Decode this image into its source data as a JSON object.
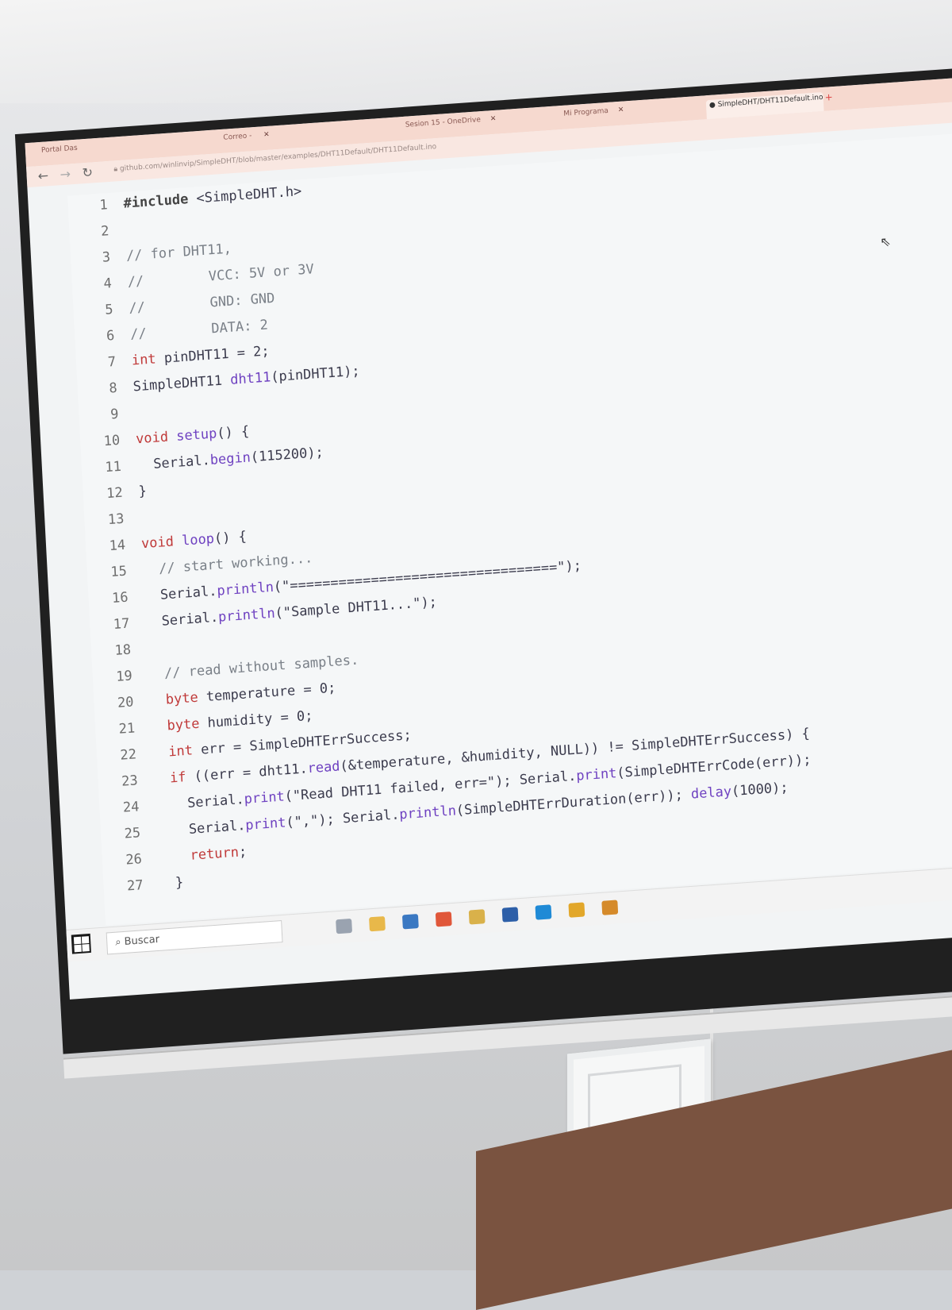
{
  "browser": {
    "tabs": [
      {
        "label": "Portal Das",
        "active": false
      },
      {
        "label": "Correo - ",
        "active": false
      },
      {
        "label": "Sesion 15 - OneDrive",
        "active": false
      },
      {
        "label": "Mi Programa",
        "active": false
      },
      {
        "label": "SimpleDHT/DHT11Default.ino",
        "active": true
      }
    ],
    "new_tab_label": "+",
    "url": "github.com/winlinvip/SimpleDHT/blob/master/examples/DHT11Default/DHT11Default.ino"
  },
  "code_lines": [
    {
      "n": "1",
      "text": "#include <SimpleDHT.h>"
    },
    {
      "n": "2",
      "text": ""
    },
    {
      "n": "3",
      "text": "// for DHT11,"
    },
    {
      "n": "4",
      "text": "//        VCC: 5V or 3V"
    },
    {
      "n": "5",
      "text": "//        GND: GND"
    },
    {
      "n": "6",
      "text": "//        DATA: 2"
    },
    {
      "n": "7",
      "text": "int pinDHT11 = 2;"
    },
    {
      "n": "8",
      "text": "SimpleDHT11 dht11(pinDHT11);"
    },
    {
      "n": "9",
      "text": ""
    },
    {
      "n": "10",
      "text": "void setup() {"
    },
    {
      "n": "11",
      "text": "  Serial.begin(115200);"
    },
    {
      "n": "12",
      "text": "}"
    },
    {
      "n": "13",
      "text": ""
    },
    {
      "n": "14",
      "text": "void loop() {"
    },
    {
      "n": "15",
      "text": "  // start working..."
    },
    {
      "n": "16",
      "text": "  Serial.println(\"=================================\");"
    },
    {
      "n": "17",
      "text": "  Serial.println(\"Sample DHT11...\");"
    },
    {
      "n": "18",
      "text": ""
    },
    {
      "n": "19",
      "text": "  // read without samples."
    },
    {
      "n": "20",
      "text": "  byte temperature = 0;"
    },
    {
      "n": "21",
      "text": "  byte humidity = 0;"
    },
    {
      "n": "22",
      "text": "  int err = SimpleDHTErrSuccess;"
    },
    {
      "n": "23",
      "text": "  if ((err = dht11.read(&temperature, &humidity, NULL)) != SimpleDHTErrSuccess) {"
    },
    {
      "n": "24",
      "text": "    Serial.print(\"Read DHT11 failed, err=\"); Serial.print(SimpleDHTErrCode(err));"
    },
    {
      "n": "25",
      "text": "    Serial.print(\",\"); Serial.println(SimpleDHTErrDuration(err)); delay(1000);"
    },
    {
      "n": "26",
      "text": "    return;"
    },
    {
      "n": "27",
      "text": "  }"
    }
  ],
  "taskbar": {
    "search_placeholder": "Buscar",
    "icons": [
      "task-view-icon",
      "file-explorer-icon",
      "mail-icon",
      "brave-icon",
      "files-icon",
      "word-icon",
      "edge-icon",
      "chrome-icon",
      "chrome-canary-icon"
    ]
  },
  "colors": {
    "keyword": "#c03a3a",
    "function": "#6f42c1",
    "comment": "#7a8088",
    "tabbar": "#f6d9cf"
  }
}
